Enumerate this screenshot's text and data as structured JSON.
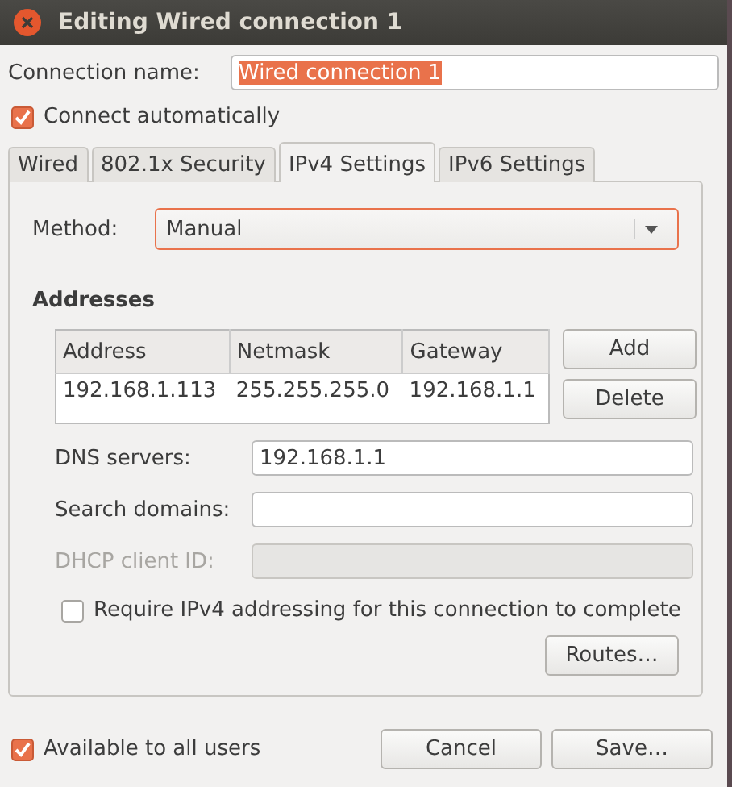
{
  "window": {
    "title": "Editing Wired connection 1"
  },
  "connection_name": {
    "label": "Connection name:",
    "value": "Wired connection 1"
  },
  "connect_automatically": {
    "label": "Connect automatically",
    "checked": true
  },
  "tabs": [
    {
      "label": "Wired",
      "selected": false
    },
    {
      "label": "802.1x Security",
      "selected": false
    },
    {
      "label": "IPv4 Settings",
      "selected": true
    },
    {
      "label": "IPv6 Settings",
      "selected": false
    }
  ],
  "method": {
    "label": "Method:",
    "value": "Manual"
  },
  "addresses": {
    "heading": "Addresses",
    "columns": [
      "Address",
      "Netmask",
      "Gateway"
    ],
    "rows": [
      [
        "192.168.1.113",
        "255.255.255.0",
        "192.168.1.1"
      ]
    ],
    "buttons": [
      "Add",
      "Delete"
    ]
  },
  "fields": [
    {
      "label": "DNS servers:",
      "value": "192.168.1.1",
      "disabled": false
    },
    {
      "label": "Search domains:",
      "disabled": false
    },
    {
      "label": "DHCP client ID:",
      "disabled": true
    }
  ],
  "require_ipv4": {
    "label": "Require IPv4 addressing for this connection to complete",
    "checked": false
  },
  "routes_button": "Routes…",
  "available_to_all_users": {
    "label": "Available to all users",
    "checked": true
  },
  "dialog_buttons": [
    "Cancel",
    "Save…"
  ]
}
